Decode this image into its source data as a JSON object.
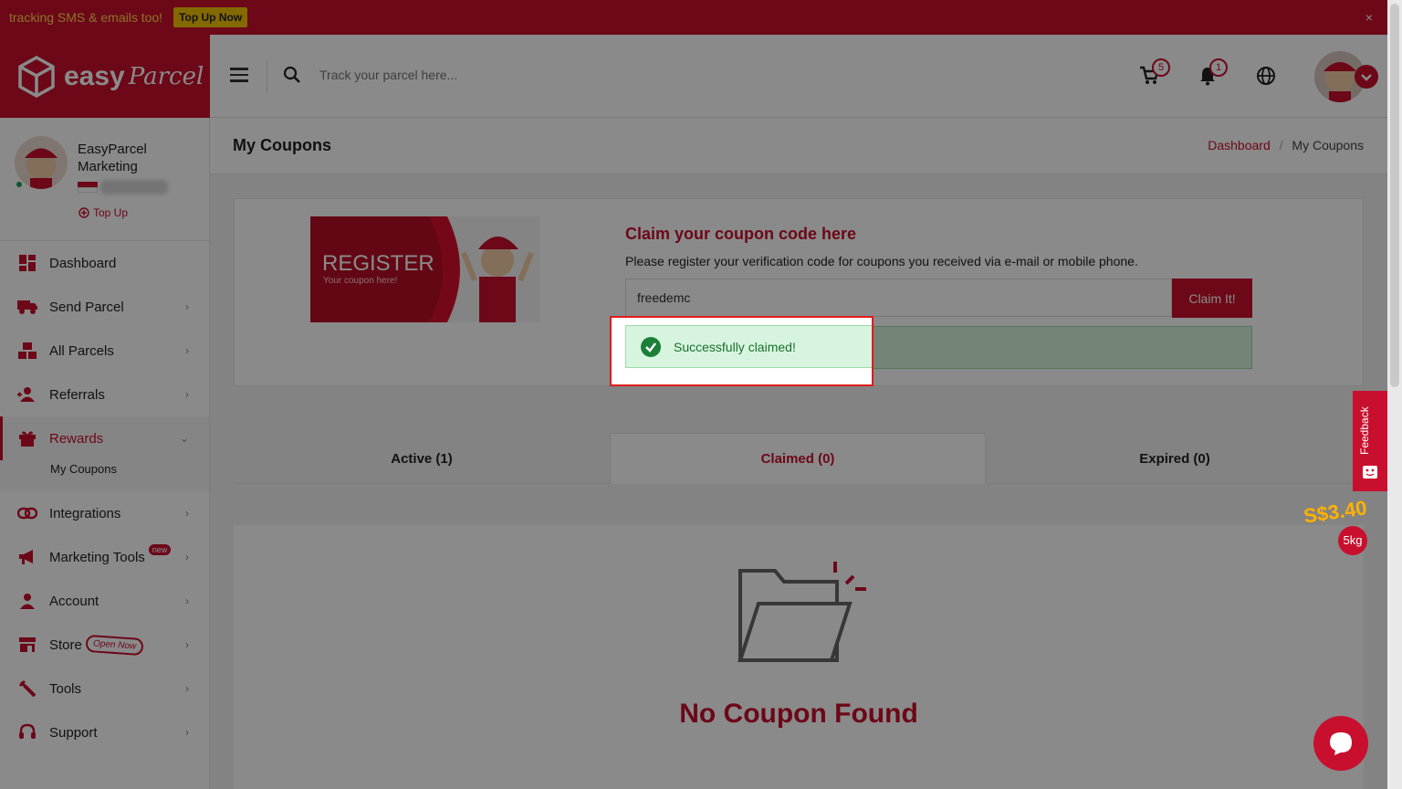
{
  "promo": {
    "text": "tracking SMS & emails too!",
    "button": "Top Up Now",
    "close": "×"
  },
  "logo": {
    "word": "easy",
    "script": "Parcel"
  },
  "header": {
    "search_placeholder": "Track your parcel here...",
    "cart_count": "5",
    "notif_count": "1"
  },
  "profile": {
    "name": "EasyParcel Marketing",
    "topup": "Top Up"
  },
  "nav": {
    "dashboard": "Dashboard",
    "send_parcel": "Send Parcel",
    "all_parcels": "All Parcels",
    "referrals": "Referrals",
    "rewards": "Rewards",
    "my_coupons": "My Coupons",
    "integrations": "Integrations",
    "marketing_tools": "Marketing Tools",
    "new_tag": "new",
    "account": "Account",
    "store": "Store",
    "open_now": "Open Now",
    "tools": "Tools",
    "support": "Support"
  },
  "page": {
    "title": "My Coupons",
    "breadcrumb_home": "Dashboard",
    "breadcrumb_sep": "/",
    "breadcrumb_current": "My Coupons"
  },
  "claim": {
    "banner_title": "REGISTER",
    "banner_sub": "Your coupon here!",
    "title": "Claim your coupon code here",
    "description": "Please register your verification code for coupons you received via e-mail or mobile phone.",
    "input_value": "freedemc",
    "button": "Claim It!",
    "success": "Successfully claimed!"
  },
  "tabs": [
    {
      "label": "Active (1)"
    },
    {
      "label": "Claimed (0)"
    },
    {
      "label": "Expired (0)"
    }
  ],
  "empty": {
    "text": "No Coupon Found"
  },
  "widgets": {
    "feedback": "Feedback",
    "price": "S$3.40",
    "weight": "5kg"
  },
  "colors": {
    "brand": "#c8102e",
    "success_bg": "#d7f5de",
    "success_fg": "#1b6f30"
  }
}
